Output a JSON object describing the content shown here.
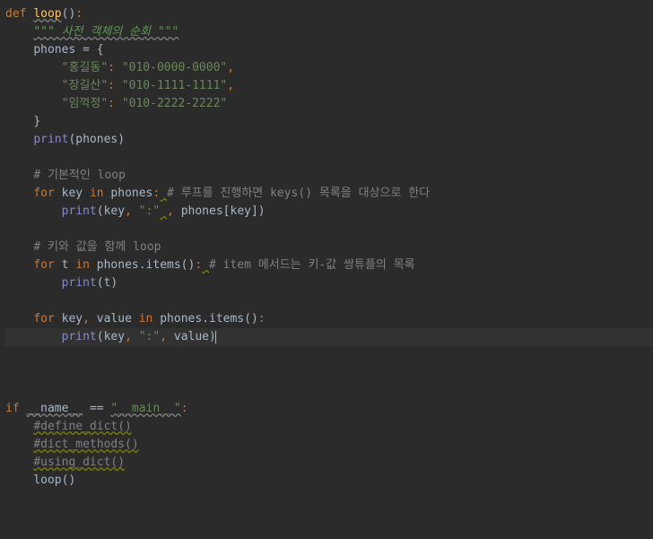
{
  "line1": {
    "def": "def",
    "sp1": " ",
    "fn": "loop",
    "p1": "()",
    "col": ":"
  },
  "line2": {
    "indent": "    ",
    "doc": "\"\"\" 사전 객체의 순회 \"\"\""
  },
  "line3": {
    "indent": "    ",
    "ident": "phones",
    "sp": " ",
    "op": "=",
    "sp2": " ",
    "brace": "{"
  },
  "line4": {
    "indent": "        ",
    "key": "\"홍길동\"",
    "col": ":",
    "sp": " ",
    "val": "\"010-0000-0000\"",
    "comma": ","
  },
  "line5": {
    "indent": "        ",
    "key": "\"장길산\"",
    "col": ":",
    "sp": " ",
    "val": "\"010-1111-1111\"",
    "comma": ","
  },
  "line6": {
    "indent": "        ",
    "key": "\"임꺽정\"",
    "col": ":",
    "sp": " ",
    "val": "\"010-2222-2222\""
  },
  "line7": {
    "indent": "    ",
    "brace": "}"
  },
  "line8": {
    "indent": "    ",
    "print": "print",
    "p1": "(",
    "arg": "phones",
    "p2": ")"
  },
  "line9": "",
  "line10": {
    "indent": "    ",
    "c": "# 기본적인 loop"
  },
  "line11": {
    "indent": "    ",
    "for": "for",
    "sp": " ",
    "k": "key",
    "sp2": " ",
    "in": "in",
    "sp3": " ",
    "obj": "phones",
    "col": ":",
    "sp4": " ",
    "c": "# 루프를 진행하면 keys() 목록을 대상으로 한다"
  },
  "line12": {
    "indent": "        ",
    "print": "print",
    "p1": "(",
    "a1": "key",
    "c1": ",",
    "sp": " ",
    "s": "\":\"",
    "sp2": " ",
    "c2": ",",
    "sp3": " ",
    "obj": "phones",
    "b1": "[",
    "a2": "key",
    "b2": "])"
  },
  "line13": "",
  "line14": {
    "indent": "    ",
    "c": "# 키와 값을 함께 loop"
  },
  "line15": {
    "indent": "    ",
    "for": "for",
    "sp": " ",
    "k": "t",
    "sp2": " ",
    "in": "in",
    "sp3": " ",
    "obj": "phones.items()",
    "col": ":",
    "sp4": " ",
    "c": "# item 메서드는 키-값 쌍튜플의 목록"
  },
  "line16": {
    "indent": "        ",
    "print": "print",
    "p1": "(",
    "a1": "t",
    "p2": ")"
  },
  "line17": "",
  "line18": {
    "indent": "    ",
    "for": "for",
    "sp": " ",
    "k": "key",
    "c1": ",",
    "sp2": " ",
    "v": "value",
    "sp3": " ",
    "in": "in",
    "sp4": " ",
    "obj": "phones.items()",
    "col": ":"
  },
  "line19": {
    "indent": "        ",
    "print": "print",
    "p1": "(",
    "a1": "key",
    "c1": ",",
    "sp": " ",
    "s": "\":\"",
    "c2": ",",
    "sp2": " ",
    "v": "value",
    "p2": ")"
  },
  "line20": "",
  "line21": "",
  "line22": "",
  "line23": {
    "kw": "if",
    "sp": " ",
    "name": "__name__",
    "sp2": " ",
    "op": "==",
    "sp3": " ",
    "str": "\"__main__\"",
    "col": ":"
  },
  "line24": {
    "indent": "    ",
    "c": "#define_dict()"
  },
  "line25": {
    "indent": "    ",
    "c": "#dict_methods()"
  },
  "line26": {
    "indent": "    ",
    "c": "#using_dict()"
  },
  "line27": {
    "indent": "    ",
    "fn": "loop",
    "p": "()"
  }
}
